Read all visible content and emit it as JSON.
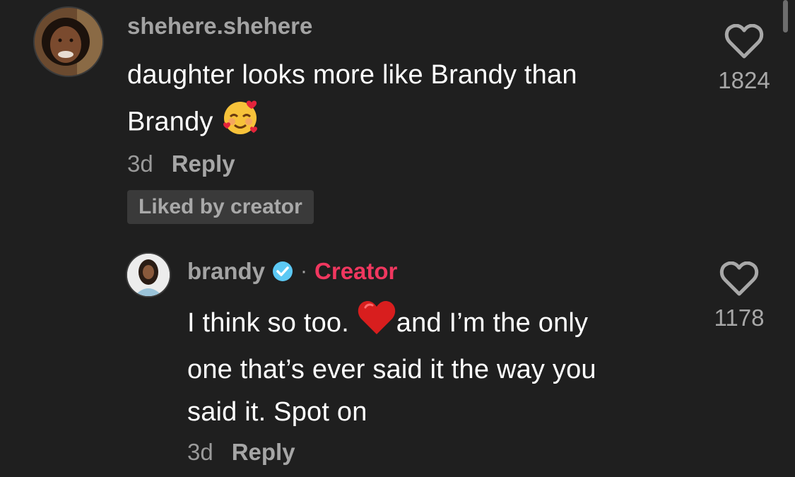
{
  "comments": [
    {
      "username": "shehere.shehere",
      "text_line1": "daughter looks more like Brandy than",
      "text_line2": "Brandy",
      "emoji": "smiling-face-with-hearts",
      "age": "3d",
      "reply_label": "Reply",
      "badge": "Liked by creator",
      "likes": "1824"
    }
  ],
  "reply": {
    "username": "brandy",
    "verified": true,
    "separator": "·",
    "creator_label": "Creator",
    "text_line1a": "I think so too.",
    "text_line1b": "and I’m the only",
    "text_line2": "one that’s ever said it the way you",
    "text_line3": "said it. Spot on",
    "emoji": "red-heart",
    "age": "3d",
    "reply_label": "Reply",
    "likes": "1178"
  },
  "colors": {
    "background": "#1f1f1f",
    "creator_accent": "#f0375f",
    "verified_blue": "#5cc9f5"
  }
}
